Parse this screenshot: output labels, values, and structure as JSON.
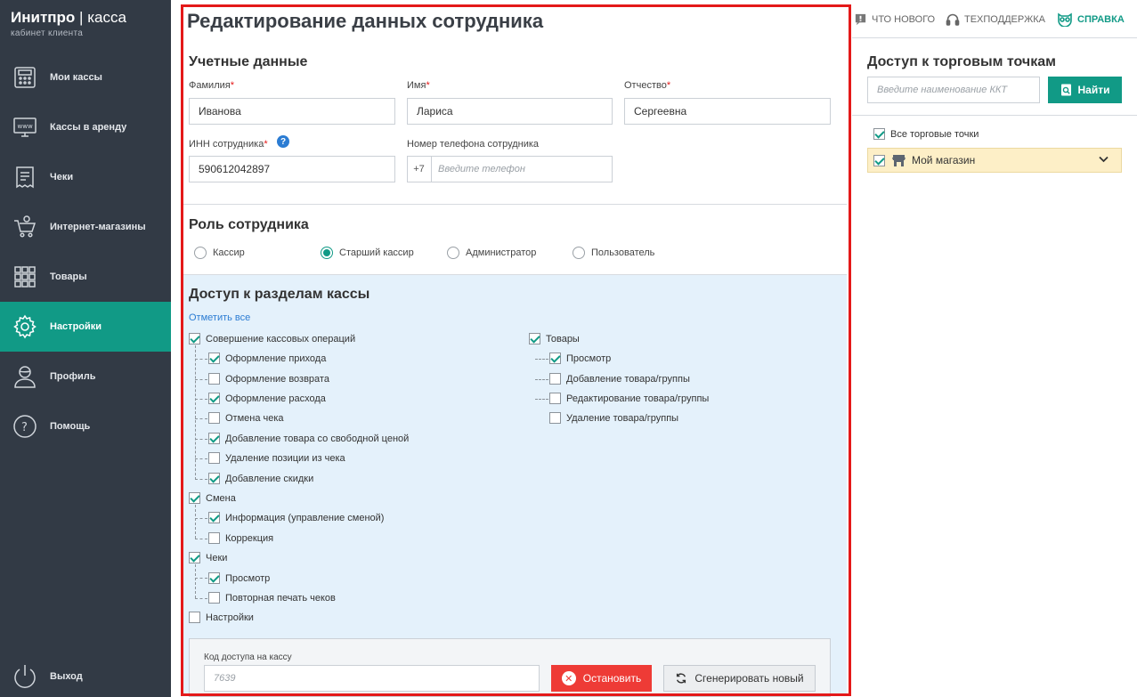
{
  "sidebar": {
    "logo_brand": "Инитпро",
    "logo_product": "касса",
    "logo_subtitle": "кабинет клиента",
    "items": [
      {
        "label": "Мои кассы",
        "icon": "cash-register-icon",
        "active": false
      },
      {
        "label": "Кассы в аренду",
        "icon": "www-monitor-icon",
        "active": false
      },
      {
        "label": "Чеки",
        "icon": "receipt-icon",
        "active": false
      },
      {
        "label": "Интернет-магазины",
        "icon": "cart-icon",
        "active": false
      },
      {
        "label": "Товары",
        "icon": "grid-icon",
        "active": false
      },
      {
        "label": "Настройки",
        "icon": "gear-icon",
        "active": true
      },
      {
        "label": "Профиль",
        "icon": "user-icon",
        "active": false
      },
      {
        "label": "Помощь",
        "icon": "question-icon",
        "active": false
      }
    ],
    "logout_label": "Выход"
  },
  "main": {
    "title": "Редактирование данных сотрудника",
    "credentials": {
      "title": "Учетные данные",
      "last_name_label": "Фамилия",
      "last_name_value": "Иванова",
      "first_name_label": "Имя",
      "first_name_value": "Лариса",
      "patronymic_label": "Отчество",
      "patronymic_value": "Сергеевна",
      "inn_label": "ИНН сотрудника",
      "inn_value": "590612042897",
      "phone_label": "Номер телефона сотрудника",
      "phone_prefix": "+7",
      "phone_placeholder": "Введите телефон",
      "help_glyph": "?",
      "required_mark": "*"
    },
    "role": {
      "title": "Роль сотрудника",
      "options": [
        {
          "label": "Кассир",
          "selected": false
        },
        {
          "label": "Старший кассир",
          "selected": true
        },
        {
          "label": "Администратор",
          "selected": false
        },
        {
          "label": "Пользователь",
          "selected": false
        }
      ]
    },
    "access": {
      "title": "Доступ к разделам кассы",
      "select_all": "Отметить все",
      "cash_ops": {
        "label": "Совершение кассовых операций",
        "checked": true
      },
      "cash_ops_children": [
        {
          "label": "Оформление прихода",
          "checked": true
        },
        {
          "label": "Оформление возврата",
          "checked": false
        },
        {
          "label": "Оформление расхода",
          "checked": true
        },
        {
          "label": "Отмена чека",
          "checked": false
        },
        {
          "label": "Добавление товара со свободной ценой",
          "checked": true
        },
        {
          "label": "Удаление позиции из чека",
          "checked": false
        },
        {
          "label": "Добавление скидки",
          "checked": true
        }
      ],
      "shift": {
        "label": "Смена",
        "checked": true
      },
      "shift_children": [
        {
          "label": "Информация (управление сменой)",
          "checked": true
        },
        {
          "label": "Коррекция",
          "checked": false
        }
      ],
      "receipts": {
        "label": "Чеки",
        "checked": true
      },
      "receipts_children": [
        {
          "label": "Просмотр",
          "checked": true
        },
        {
          "label": "Повторная печать чеков",
          "checked": false
        }
      ],
      "settings": {
        "label": "Настройки",
        "checked": false
      },
      "goods": {
        "label": "Товары",
        "checked": true
      },
      "goods_children": [
        {
          "label": "Просмотр",
          "checked": true
        },
        {
          "label": "Добавление товара/группы",
          "checked": false
        },
        {
          "label": "Редактирование товара/группы",
          "checked": false
        },
        {
          "label": "Удаление товара/группы",
          "checked": false
        }
      ]
    },
    "access_code": {
      "label": "Код доступа на кассу",
      "placeholder": "7639",
      "stop_label": "Остановить",
      "stop_glyph": "✕",
      "regenerate_label": "Сгенерировать новый"
    }
  },
  "topbar": {
    "whats_new": "ЧТО НОВОГО",
    "support": "ТЕХПОДДЕРЖКА",
    "help": "СПРАВКА"
  },
  "right": {
    "title": "Доступ к торговым точкам",
    "search_placeholder": "Введите наименование ККТ",
    "find_label": "Найти",
    "all_points_label": "Все торговые точки",
    "all_points_checked": true,
    "store_label": "Мой магазин",
    "store_checked": true
  },
  "colors": {
    "accent": "#119a86",
    "sidebar_bg": "#323a45",
    "danger": "#ee3b36",
    "highlight_frame": "#e41919",
    "access_bg": "#e4f1fb",
    "store_row_bg": "#fdefc7"
  }
}
